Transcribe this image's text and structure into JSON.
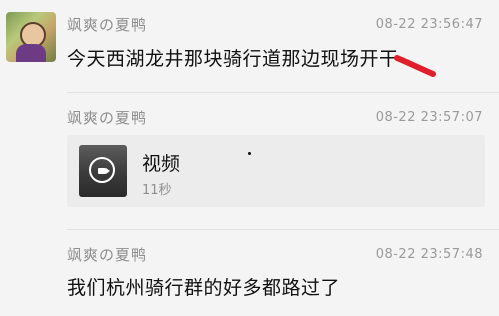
{
  "messages": [
    {
      "sender": "飒爽の夏鸭",
      "time": "08-22 23:56:47",
      "text": "今天西湖龙井那块骑行道那边现场开干"
    },
    {
      "sender": "飒爽の夏鸭",
      "time": "08-22 23:57:07",
      "video": {
        "label": "视频",
        "duration": "11秒",
        "icon": "video-camera-icon"
      }
    },
    {
      "sender": "飒爽の夏鸭",
      "time": "08-22 23:57:48",
      "text": "我们杭州骑行群的好多都路过了"
    }
  ],
  "colors": {
    "background": "#f4f4f4",
    "annotation_mark": "#e01f2a"
  }
}
